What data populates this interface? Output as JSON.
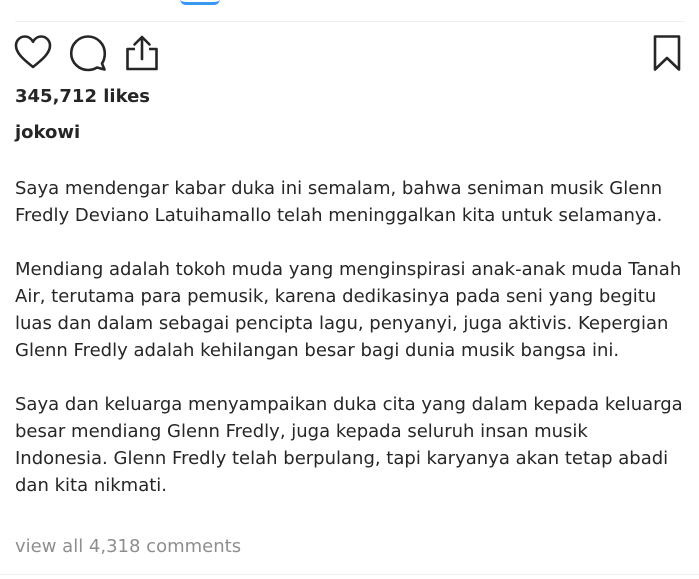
{
  "post": {
    "likes_text": "345,712 likes",
    "username": "jokowi",
    "caption_paragraphs": [
      "Saya mendengar kabar duka ini semalam, bahwa seniman musik Glenn Fredly Deviano Latuihamallo telah meninggalkan kita untuk selamanya.",
      "Mendiang adalah tokoh muda yang menginspirasi anak-anak muda Tanah Air, terutama para pemusik, karena dedikasinya pada seni yang begitu luas dan dalam sebagai pencipta lagu, penyanyi, juga aktivis. Kepergian Glenn Fredly adalah kehilangan besar bagi dunia musik bangsa ini.",
      "Saya dan keluarga menyampaikan duka cita yang dalam kepada keluarga besar mendiang Glenn Fredly, juga kepada seluruh insan musik Indonesia. Glenn Fredly telah berpulang, tapi karyanya akan tetap abadi dan kita nikmati."
    ],
    "view_comments_text": "view all 4,318 comments"
  },
  "actions": {
    "like_icon": "heart-icon",
    "comment_icon": "comment-bubble-icon",
    "share_icon": "share-icon",
    "save_icon": "bookmark-icon"
  },
  "colors": {
    "text": "#262626",
    "muted": "#8e8e8e",
    "link": "#3897f0",
    "divider": "#efefef"
  }
}
